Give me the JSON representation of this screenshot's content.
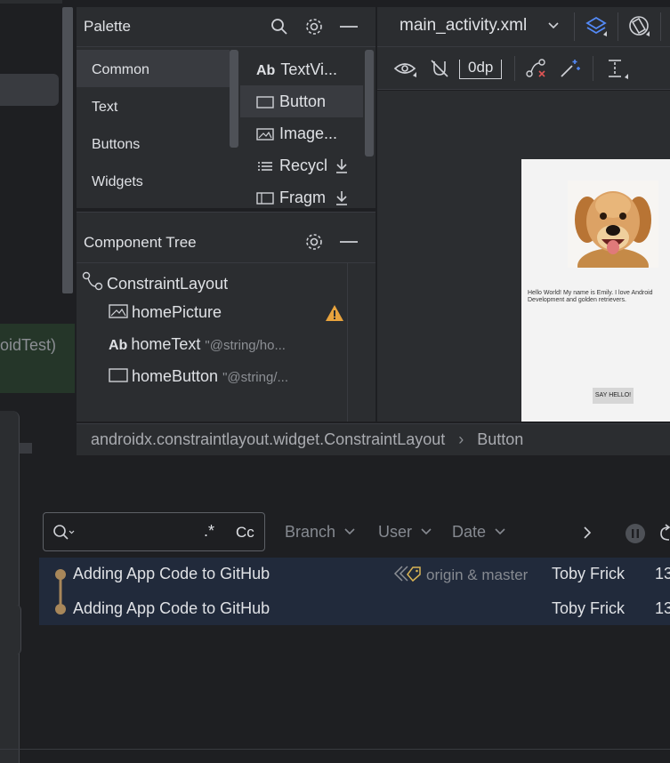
{
  "left_strip": {
    "run_text": "oidTest)"
  },
  "palette": {
    "title": "Palette",
    "categories": [
      "Common",
      "Text",
      "Buttons",
      "Widgets"
    ],
    "items": [
      {
        "icon": "text-view-icon",
        "label": "TextVi...",
        "prefix": "Ab"
      },
      {
        "icon": "button-icon",
        "label": "Button"
      },
      {
        "icon": "image-icon",
        "label": "Image..."
      },
      {
        "icon": "list-icon",
        "label": "Recycl"
      },
      {
        "icon": "fragment-icon",
        "label": "Fragm"
      }
    ]
  },
  "component_tree": {
    "title": "Component Tree",
    "root": "ConstraintLayout",
    "children": [
      {
        "name": "homePicture",
        "attr": "",
        "warning": true
      },
      {
        "name": "homeText",
        "attr": "\"@string/ho...",
        "prefix": "Ab"
      },
      {
        "name": "homeButton",
        "attr": "\"@string/..."
      }
    ]
  },
  "design": {
    "file_tab": "main_activity.xml",
    "margin_value": "0dp",
    "preview_text": "Hello World! My name is Emily. I love Android Development and golden retrievers.",
    "preview_button": "SAY HELLO!"
  },
  "breadcrumb": {
    "path": "androidx.constraintlayout.widget.ConstraintLayout",
    "separator": "›",
    "current": "Button"
  },
  "git_log": {
    "search_regex": ".*",
    "search_case": "Cc",
    "filters": [
      "Branch",
      "User",
      "Date"
    ],
    "commits": [
      {
        "message": "Adding App Code to GitHub",
        "refs": "origin & master",
        "author": "Toby Frick",
        "date": "13"
      },
      {
        "message": "Adding App Code to GitHub",
        "refs": "",
        "author": "Toby Frick",
        "date": "13"
      }
    ]
  },
  "colors": {
    "accent_blue": "#548af7",
    "warning": "#e8a33d",
    "commit_node": "#a8875a"
  }
}
